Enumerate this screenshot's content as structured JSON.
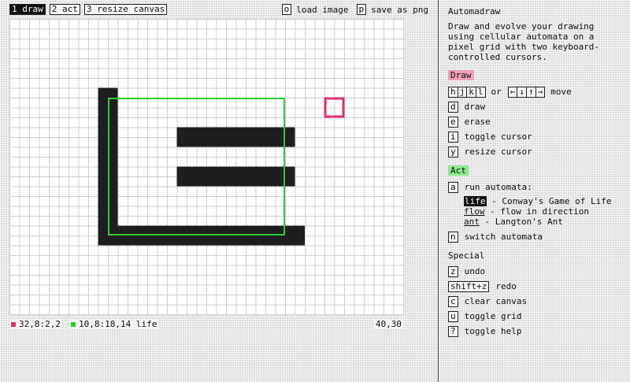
{
  "topbar": {
    "tabs": [
      {
        "key": "1 draw",
        "active": true
      },
      {
        "key": "2 act",
        "active": false
      },
      {
        "key": "3 resize canvas",
        "active": false
      }
    ],
    "actions": [
      {
        "key": "o",
        "label": "load image"
      },
      {
        "key": "p",
        "label": "save as png"
      }
    ]
  },
  "canvas": {
    "grid_cols": 40,
    "grid_rows": 30,
    "filled_cells": [
      {
        "x": 9,
        "y": 7,
        "w": 2,
        "h": 16
      },
      {
        "x": 11,
        "y": 21,
        "w": 19,
        "h": 2
      },
      {
        "x": 17,
        "y": 11,
        "w": 12,
        "h": 2
      },
      {
        "x": 17,
        "y": 15,
        "w": 12,
        "h": 2
      }
    ],
    "cursor_pink": {
      "x": 32,
      "y": 8,
      "w": 2,
      "h": 2,
      "color": "#e0306a"
    },
    "cursor_green": {
      "x": 10,
      "y": 8,
      "w": 18,
      "h": 14,
      "color": "#2ecc2e"
    }
  },
  "status": {
    "pink_cursor": "32,8:2,2",
    "green_cursor": "10,8:18,14 life",
    "grid_size": "40,30",
    "pink_color": "#e0306a",
    "green_color": "#2ecc2e"
  },
  "panel": {
    "title": "Automadraw",
    "description": "Draw and evolve your drawing using cellular automata on a pixel grid with two keyboard-controlled cursors.",
    "draw": {
      "label": "Draw",
      "color": "#f0a0b8",
      "move_keys": [
        "h",
        "j",
        "k",
        "l"
      ],
      "or": "or",
      "arrow_keys": [
        "←",
        "↓",
        "↑",
        "→"
      ],
      "move_label": "move",
      "items": [
        {
          "key": "d",
          "label": "draw"
        },
        {
          "key": "e",
          "label": "erase"
        },
        {
          "key": "i",
          "label": "toggle cursor"
        },
        {
          "key": "y",
          "label": "resize cursor"
        }
      ]
    },
    "act": {
      "label": "Act",
      "color": "#8ee88e",
      "run": {
        "key": "a",
        "label": "run automata:"
      },
      "automata": [
        {
          "name": "life",
          "desc": " - Conway's Game of Life",
          "active": true
        },
        {
          "name": "flow",
          "desc": " - flow in direction",
          "active": false
        },
        {
          "name": "ant",
          "desc": " - Langton's Ant",
          "active": false
        }
      ],
      "switch": {
        "key": "n",
        "label": "switch automata"
      }
    },
    "special": {
      "label": "Special",
      "items": [
        {
          "key": "z",
          "label": "undo"
        },
        {
          "key": "shift+z",
          "label": "redo"
        },
        {
          "key": "c",
          "label": "clear canvas"
        },
        {
          "key": "u",
          "label": "toggle grid"
        },
        {
          "key": "?",
          "label": "toggle help"
        }
      ]
    }
  }
}
